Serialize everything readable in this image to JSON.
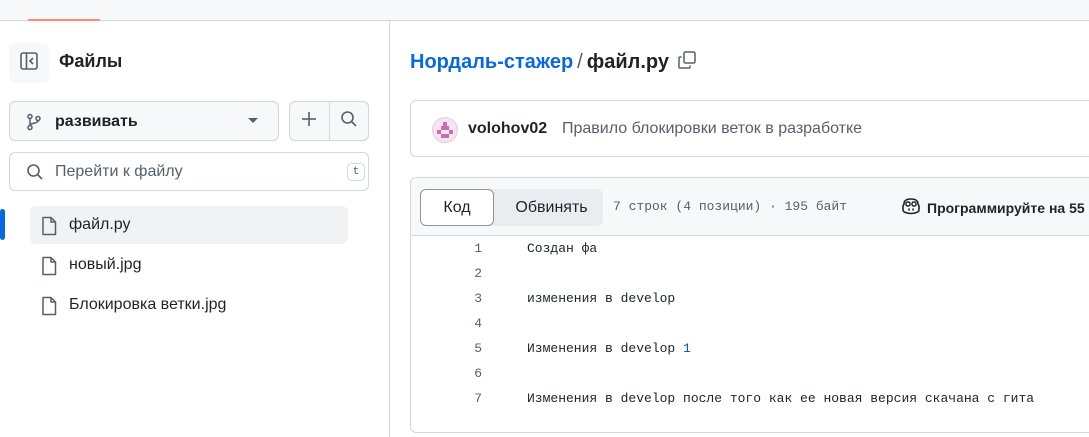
{
  "sidebar": {
    "title": "Файлы",
    "branch": "развивать",
    "goto_placeholder": "Перейти к файлу",
    "goto_shortcut": "t",
    "files": [
      {
        "name": "файл.ру",
        "active": true
      },
      {
        "name": "новый.jpg",
        "active": false
      },
      {
        "name": "Блокировка ветки.jpg",
        "active": false
      }
    ]
  },
  "breadcrumb": {
    "repo": "Нордаль-стажер",
    "separator": "/",
    "file": "файл.ру"
  },
  "commit": {
    "author": "volohov02",
    "message": "Правило блокировки веток в разработке"
  },
  "file_view": {
    "tab_code": "Код",
    "tab_blame": "Обвинять",
    "meta": "7 строк (4 позиции) · 195 байт",
    "copilot_label": "Программируйте на 55",
    "lines": [
      {
        "n": "1",
        "text": "Создан фа"
      },
      {
        "n": "2",
        "text": ""
      },
      {
        "n": "3",
        "text": "изменения в develop"
      },
      {
        "n": "4",
        "text": ""
      },
      {
        "n": "5",
        "text": "Изменения в develop ",
        "num": "1"
      },
      {
        "n": "6",
        "text": ""
      },
      {
        "n": "7",
        "text": "Изменения в develop после того как ее новая версия скачана с гита"
      }
    ]
  },
  "colors": {
    "link": "#0969da",
    "border": "#d0d7de",
    "muted": "#57606a",
    "active_indicator": "#0969da",
    "tab_indicator": "#fd8c73"
  },
  "icons": [
    "sidebar-collapse-icon",
    "git-branch-icon",
    "plus-icon",
    "search-icon",
    "file-icon",
    "copy-icon",
    "copilot-icon"
  ]
}
